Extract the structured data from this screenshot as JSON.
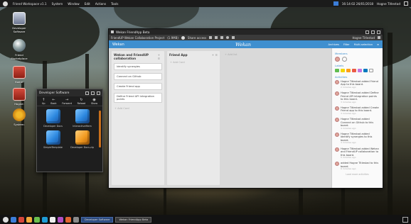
{
  "topbar": {
    "app_name": "Friend Workspace v1.1",
    "menus": [
      "System",
      "Window",
      "Edit",
      "Actions",
      "Tools"
    ],
    "clock": "16:14:02 26/01/2018",
    "user": "Hogne Titlestad"
  },
  "desktop_icons": [
    {
      "label": "Developer Software",
      "icon": "monitor-icon"
    },
    {
      "label": "Friend Marketplace",
      "icon": "globe-icon"
    },
    {
      "label": "Home:",
      "icon": "disk-icon"
    },
    {
      "label": "Hogne:",
      "icon": "disk-icon"
    },
    {
      "label": "System:",
      "icon": "gear-icon"
    }
  ],
  "wekan": {
    "window_title": "Wekan FriendApp Beta",
    "tab_title": "FriendUP Wekan Collaboration Project",
    "tab_size": "(1.9MB)",
    "share_label": "Share access",
    "user": "Hogne Titlestad",
    "header_title": "Wekan",
    "brand": "Wekan",
    "header_links": [
      "Archives",
      "Filter",
      "Multi-selection"
    ],
    "lists": [
      {
        "title": "Wekan and FriendUP collaboration",
        "cards": [
          "Identify synergies",
          "Connect on Github",
          "Create Friend app",
          "Define Friend API integration points"
        ],
        "add_card": "Add Card"
      },
      {
        "title": "Friend App",
        "cards": [],
        "add_card": "Add Card"
      }
    ],
    "add_list": "Add list",
    "sidebar": {
      "members_label": "Members",
      "labels_label": "Labels",
      "label_colors": [
        "#61bd4f",
        "#f2d600",
        "#ff9f1a",
        "#eb5a46",
        "#c377e0",
        "#0079bf"
      ],
      "activity_label": "Activities",
      "activities": [
        {
          "text": "Hogne Titlestad added Friend App to this board.",
          "time": "2 minutes ago"
        },
        {
          "text": "Hogne Titlestad added Define Friend API integration points to this board.",
          "time": "3 minutes ago"
        },
        {
          "text": "Hogne Titlestad added Create Friend app to this board.",
          "time": "3 minutes ago"
        },
        {
          "text": "Hogne Titlestad added Connect on Github to this board.",
          "time": "4 minutes ago"
        },
        {
          "text": "Hogne Titlestad added Identify synergies to this board.",
          "time": "4 minutes ago"
        },
        {
          "text": "Hogne Titlestad added Wekan and FriendUP collaboration to this board.",
          "time": "5 minutes ago"
        },
        {
          "text": "added Hogne Titlestad to this board.",
          "time": "6 minutes ago"
        }
      ],
      "footer": "Load more activities"
    }
  },
  "devsoft": {
    "title": "Developer Software",
    "tools": [
      "Up",
      "Back",
      "Forward",
      "Reload",
      "Show"
    ],
    "items": [
      {
        "label": "Developer Docs",
        "color": "blue"
      },
      {
        "label": "InteractiveMem",
        "color": "blue"
      },
      {
        "label": "SimpleTemplate",
        "color": "blue"
      },
      {
        "label": "Developer Docs.zip",
        "color": "orange"
      }
    ]
  },
  "taskbar": {
    "tasks": [
      "Developer Software",
      "Wekan FriendApp Beta"
    ]
  }
}
